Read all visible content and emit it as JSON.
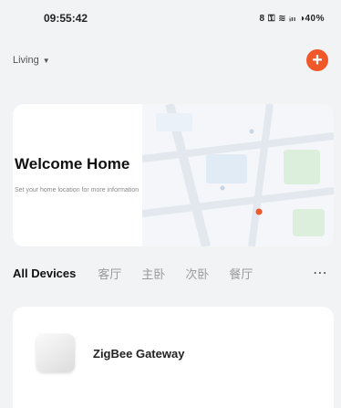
{
  "status_bar": {
    "time": "09:55:42",
    "indicators": "8 ⚿ ≋ ᵢₗₗ ◑40%"
  },
  "header": {
    "home_name": "Living",
    "dropdown_icon": "chevron-down-icon",
    "add_icon_symbol": "+"
  },
  "welcome_card": {
    "title": "Welcome Home",
    "subtitle": "Set your home location for more information"
  },
  "tabs": [
    {
      "label": "All Devices",
      "active": true
    },
    {
      "label": "客厅",
      "active": false
    },
    {
      "label": "主卧",
      "active": false
    },
    {
      "label": "次卧",
      "active": false
    },
    {
      "label": "餐厅",
      "active": false
    }
  ],
  "tabs_more": "⋯",
  "devices": [
    {
      "name": "ZigBee Gateway"
    }
  ],
  "colors": {
    "accent": "#f0582a",
    "background": "#f2f3f5",
    "card": "#ffffff"
  }
}
